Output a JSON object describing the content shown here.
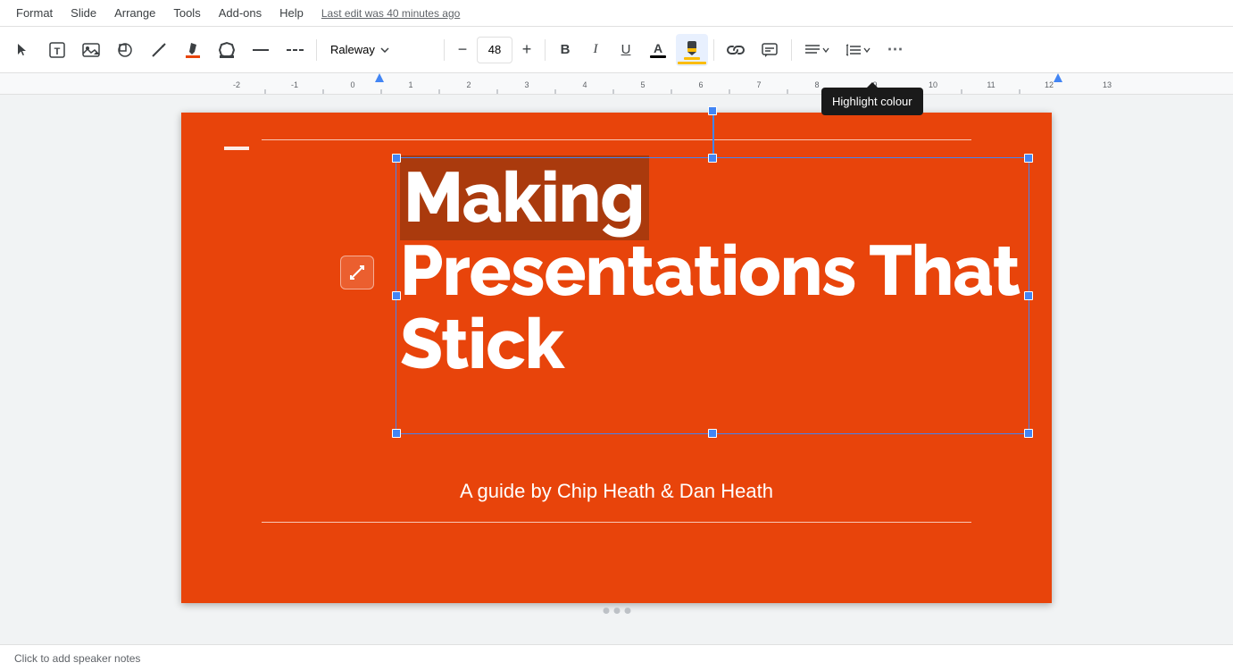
{
  "menubar": {
    "items": [
      "Format",
      "Slide",
      "Arrange",
      "Tools",
      "Add-ons",
      "Help"
    ],
    "last_edit": "Last edit was 40 minutes ago"
  },
  "toolbar": {
    "font": "Raleway",
    "font_size": "48",
    "bold_label": "B",
    "italic_label": "I",
    "underline_label": "U",
    "text_color_label": "A",
    "highlight_label": "✏",
    "link_label": "🔗",
    "comment_label": "💬",
    "align_label": "≡",
    "line_spacing_label": "↕",
    "more_label": "⋯"
  },
  "tooltip": {
    "text": "Highlight colour"
  },
  "slide": {
    "title_line1": "Making",
    "title_highlight": "Making",
    "title_line2": "Presentations That",
    "title_line3": "Stick",
    "subtitle": "A guide by Chip Heath & Dan Heath",
    "bg_color": "#e8440b"
  },
  "notes": {
    "placeholder": "Click to add speaker notes"
  }
}
